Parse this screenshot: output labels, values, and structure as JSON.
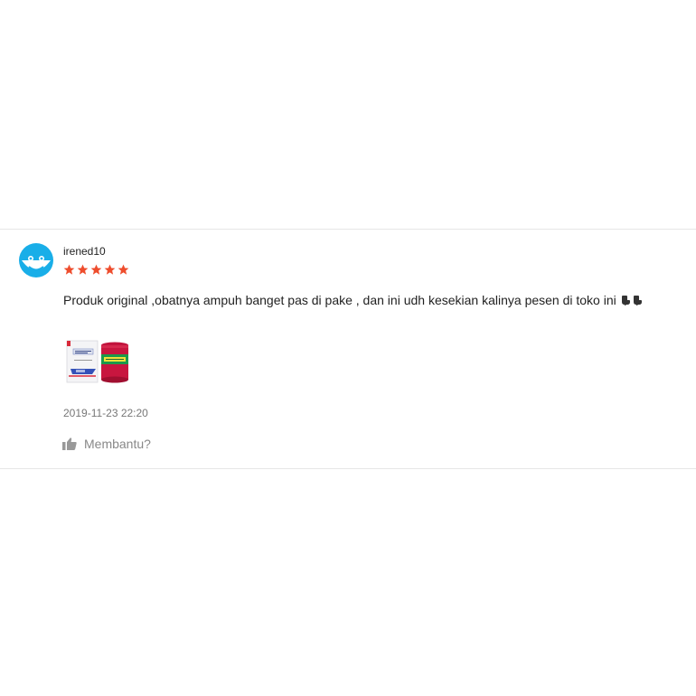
{
  "review": {
    "username": "irened10",
    "rating": 5,
    "rating_max": 5,
    "comment": "Produk original ,obatnya ampuh banget pas di pake , dan ini udh kesekian kalinya pesen di toko ini",
    "comment_emoji": [
      "backhand-index-pointing-down",
      "backhand-index-pointing-down"
    ],
    "photos": [
      {
        "description_icon": "product-box-and-jar-photo"
      }
    ],
    "timestamp": "2019-11-23 22:20",
    "helpful_label": "Membantu?"
  },
  "colors": {
    "star": "#ee4d2d",
    "avatar": "#19aee8",
    "text": "#222222",
    "muted": "#777777",
    "divider": "#e6e6e6"
  }
}
